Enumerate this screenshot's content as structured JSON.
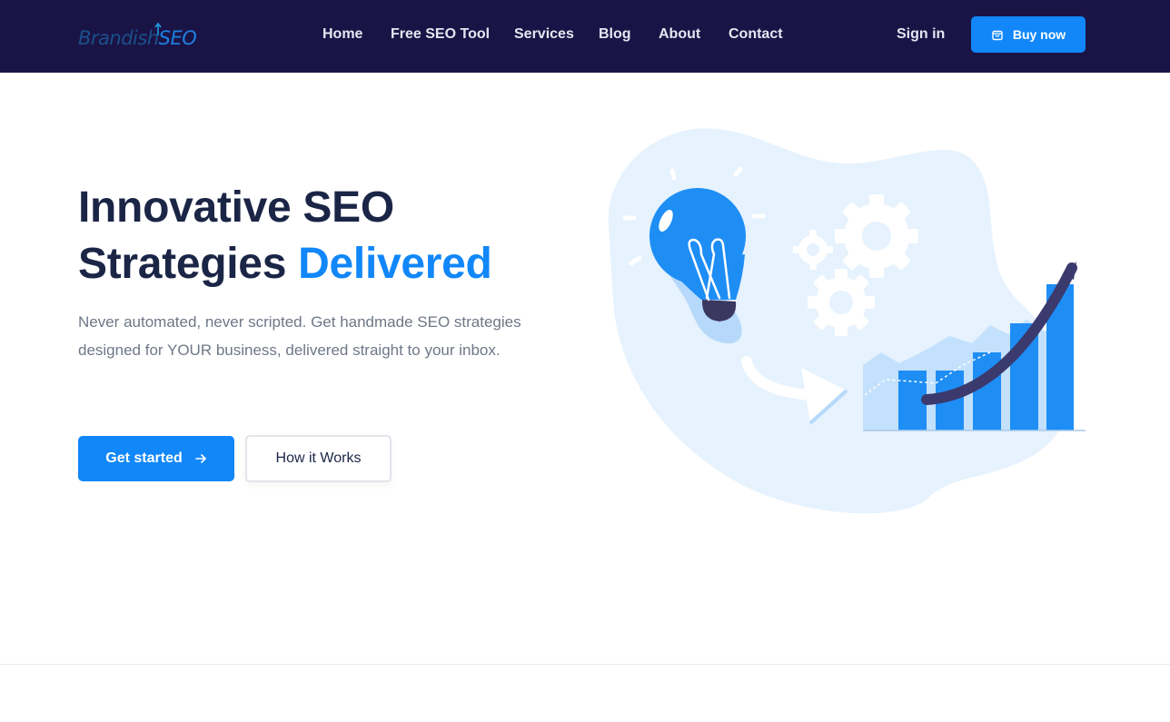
{
  "header": {
    "logo": {
      "part1": "Brandish",
      "part2": "SEO"
    },
    "nav": [
      {
        "label": "Home"
      },
      {
        "label": "Free SEO Tool"
      },
      {
        "label": "Services"
      },
      {
        "label": "Blog"
      },
      {
        "label": "About"
      },
      {
        "label": "Contact"
      }
    ],
    "signin_label": "Sign in",
    "buy_label": "Buy now",
    "buy_icon": "shopping-bag-icon"
  },
  "hero": {
    "title_line1": "Innovative SEO",
    "title_line2": "Strategies",
    "title_accent": "Delivered",
    "description": "Never automated, never scripted. Get handmade SEO strategies designed for YOUR business, delivered straight to your inbox.",
    "primary_button": "Get started",
    "primary_icon": "arrow-right-icon",
    "secondary_button": "How it Works"
  },
  "colors": {
    "header_bg": "#1a1446",
    "accent": "#1187f9",
    "heading": "#1b2546",
    "body_text": "#6f7787",
    "blob": "#e6f2fd"
  }
}
